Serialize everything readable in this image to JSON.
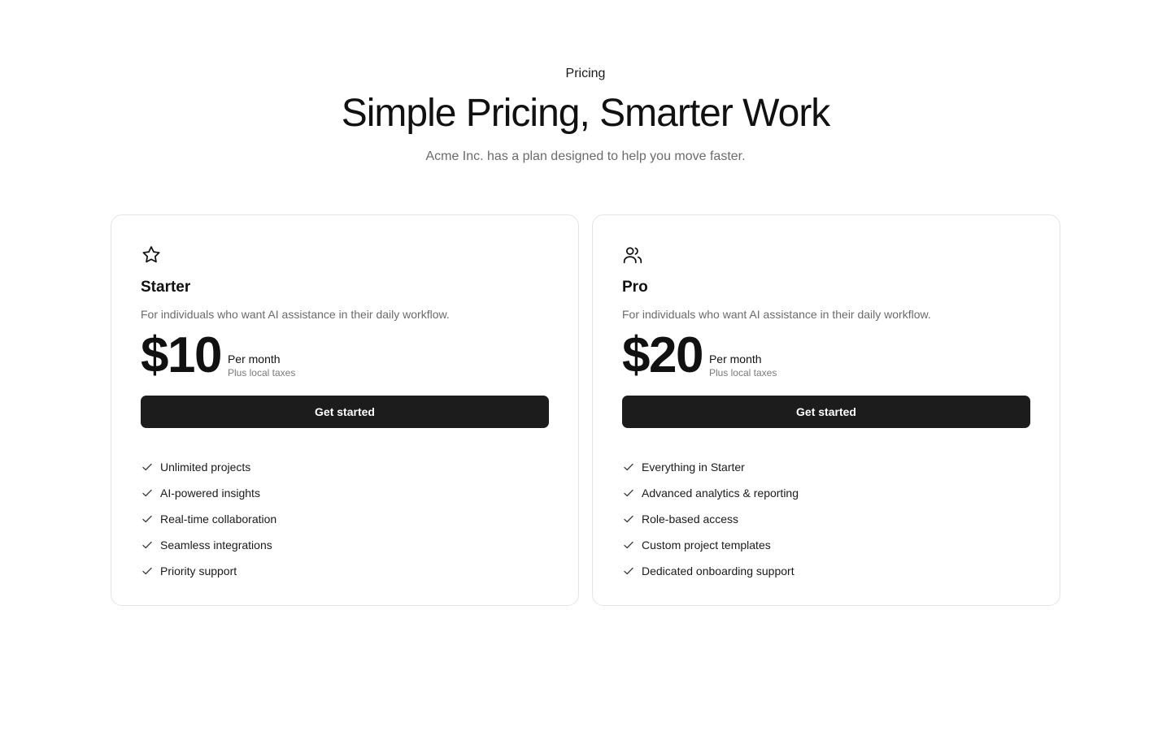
{
  "header": {
    "eyebrow": "Pricing",
    "title": "Simple Pricing, Smarter Work",
    "subtitle": "Acme Inc. has a plan designed to help you move faster."
  },
  "plans": [
    {
      "icon": "star-icon",
      "name": "Starter",
      "description": "For individuals who want AI assistance in their daily workflow.",
      "price": "$10",
      "period": "Per month",
      "tax_note": "Plus local taxes",
      "cta": "Get started",
      "features": [
        "Unlimited projects",
        "AI-powered insights",
        "Real-time collaboration",
        "Seamless integrations",
        "Priority support"
      ]
    },
    {
      "icon": "users-icon",
      "name": "Pro",
      "description": "For individuals who want AI assistance in their daily workflow.",
      "price": "$20",
      "period": "Per month",
      "tax_note": "Plus local taxes",
      "cta": "Get started",
      "features": [
        "Everything in Starter",
        "Advanced analytics & reporting",
        "Role-based access",
        "Custom project templates",
        "Dedicated onboarding support"
      ]
    }
  ],
  "colors": {
    "button_bg": "#1c1c1c",
    "muted_text": "#6b6b6b",
    "card_border": "#e4e4e4"
  }
}
